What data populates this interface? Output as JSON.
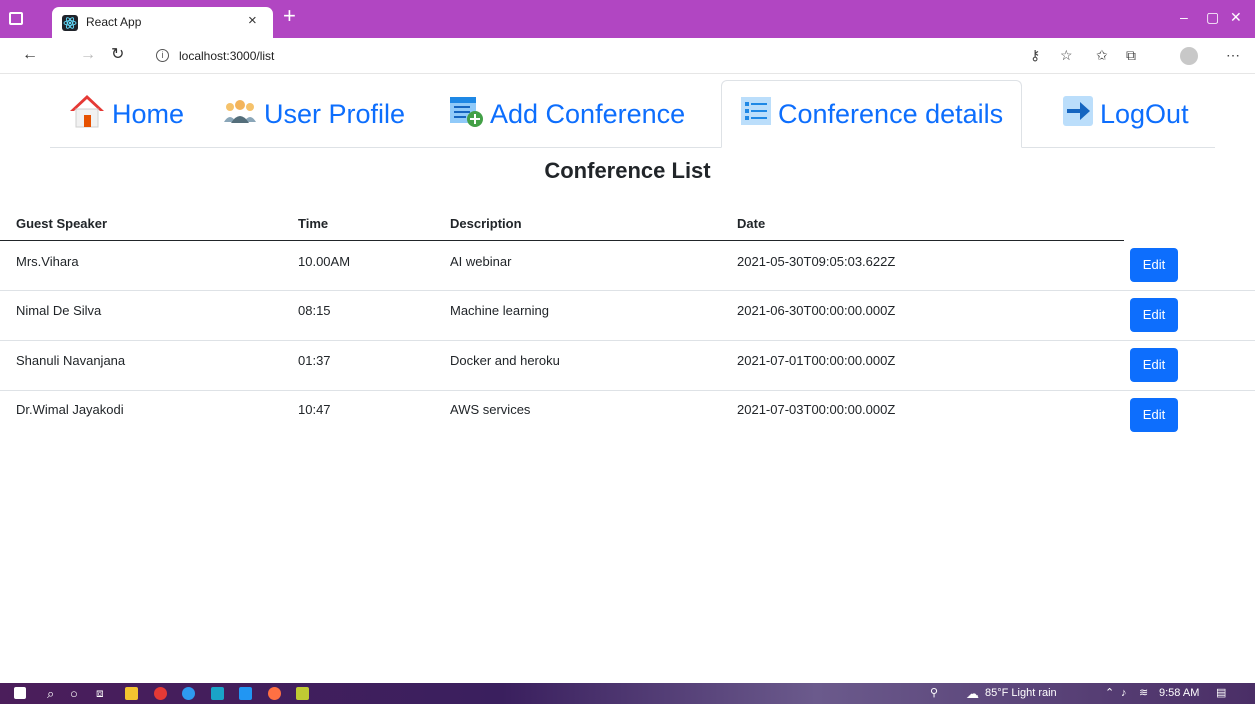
{
  "browser": {
    "tab_title": "React App",
    "tab_close_glyph": "×",
    "newtab_glyph": "+",
    "url": "localhost:3000/list",
    "window_controls": [
      "–",
      "▢",
      "✕"
    ]
  },
  "nav": {
    "items": [
      {
        "label": "Home",
        "icon": "home-icon"
      },
      {
        "label": "User Profile",
        "icon": "users-icon"
      },
      {
        "label": "Add Conference",
        "icon": "add-document-icon"
      },
      {
        "label": "Conference details",
        "icon": "list-icon",
        "active": true
      },
      {
        "label": "LogOut",
        "icon": "logout-arrow-icon"
      }
    ]
  },
  "page": {
    "title": "Conference List"
  },
  "table": {
    "headers": [
      "Guest Speaker",
      "Time",
      "Description",
      "Date"
    ],
    "rows": [
      {
        "speaker": "Mrs.Vihara",
        "time": "10.00AM",
        "description": "AI webinar",
        "date": "2021-05-30T09:05:03.622Z",
        "action": "Edit"
      },
      {
        "speaker": "Nimal De Silva",
        "time": "08:15",
        "description": "Machine learning",
        "date": "2021-06-30T00:00:00.000Z",
        "action": "Edit"
      },
      {
        "speaker": "Shanuli Navanjana",
        "time": "01:37",
        "description": "Docker and heroku",
        "date": "2021-07-01T00:00:00.000Z",
        "action": "Edit"
      },
      {
        "speaker": "Dr.Wimal Jayakodi",
        "time": "10:47",
        "description": "AWS services",
        "date": "2021-07-03T00:00:00.000Z",
        "action": "Edit"
      }
    ]
  },
  "taskbar": {
    "weather": "85°F  Light rain",
    "time": "9:58 AM"
  },
  "colors": {
    "titlebar": "#b146c2",
    "primary": "#0d6efd"
  }
}
